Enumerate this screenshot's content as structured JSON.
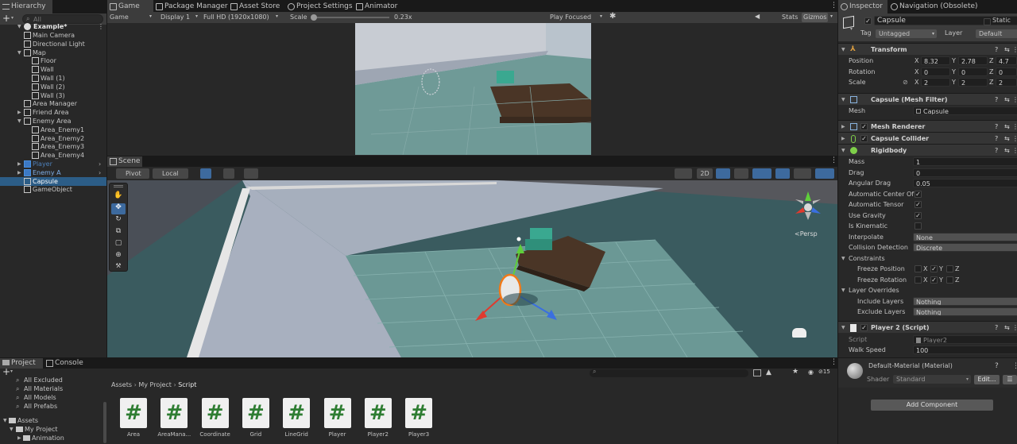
{
  "hierarchy": {
    "tab": "Hierarchy",
    "search_placeholder": "All",
    "scene_name": "Example*",
    "rows": [
      {
        "label": "Main Camera"
      },
      {
        "label": "Directional Light"
      },
      {
        "label": "Map"
      },
      {
        "label": "Floor"
      },
      {
        "label": "Wall"
      },
      {
        "label": "Wall (1)"
      },
      {
        "label": "Wall (2)"
      },
      {
        "label": "Wall (3)"
      },
      {
        "label": "Area Manager"
      },
      {
        "label": "Friend Area"
      },
      {
        "label": "Enemy Area"
      },
      {
        "label": "Area_Enemy1"
      },
      {
        "label": "Area_Enemy2"
      },
      {
        "label": "Area_Enemy3"
      },
      {
        "label": "Area_Enemy4"
      },
      {
        "label": "Player"
      },
      {
        "label": "Enemy A"
      },
      {
        "label": "Capsule"
      },
      {
        "label": "GameObject"
      }
    ]
  },
  "center_tabs": [
    "Game",
    "Package Manager",
    "Asset Store",
    "Project Settings",
    "Animator"
  ],
  "game_toolbar": {
    "mode": "Game",
    "display": "Display 1",
    "resolution": "Full HD (1920x1080)",
    "scale_label": "Scale",
    "scale_value": "0.23x",
    "play_mode": "Play Focused",
    "stats": "Stats",
    "gizmos": "Gizmos"
  },
  "scene": {
    "tab": "Scene",
    "pivot": "Pivot",
    "local": "Local",
    "mode_2d": "2D",
    "persp": "<Persp"
  },
  "bottom": {
    "tabs": [
      "Project",
      "Console"
    ],
    "favorites": [
      "All Excluded",
      "All Materials",
      "All Models",
      "All Prefabs"
    ],
    "tree": [
      "Assets",
      "My Project",
      "Animation"
    ],
    "breadcrumb": [
      "Assets",
      "My Project",
      "Script"
    ],
    "count": "15",
    "assets": [
      "Area",
      "AreaMana...",
      "Coordinate",
      "Grid",
      "LineGrid",
      "Player",
      "Player2",
      "Player3"
    ]
  },
  "inspector": {
    "tabs": [
      "Inspector",
      "Navigation (Obsolete)"
    ],
    "object_name": "Capsule",
    "static_label": "Static",
    "tag_label": "Tag",
    "tag_value": "Untagged",
    "layer_label": "Layer",
    "layer_value": "Default",
    "transform": {
      "title": "Transform",
      "position_label": "Position",
      "position": [
        "8.32",
        "2.78",
        "4.7"
      ],
      "rotation_label": "Rotation",
      "rotation": [
        "0",
        "0",
        "0"
      ],
      "scale_label": "Scale",
      "scale": [
        "2",
        "2",
        "2"
      ]
    },
    "mesh_filter": {
      "title": "Capsule (Mesh Filter)",
      "mesh_label": "Mesh",
      "mesh_value": "Capsule"
    },
    "mesh_renderer": "Mesh Renderer",
    "capsule_collider": "Capsule Collider",
    "rigidbody": {
      "title": "Rigidbody",
      "rows": [
        {
          "label": "Mass",
          "value": "1"
        },
        {
          "label": "Drag",
          "value": "0"
        },
        {
          "label": "Angular Drag",
          "value": "0.05"
        },
        {
          "label": "Automatic Center Of I",
          "value": "✓"
        },
        {
          "label": "Automatic Tensor",
          "value": "✓"
        },
        {
          "label": "Use Gravity",
          "value": "✓"
        },
        {
          "label": "Is Kinematic",
          "value": ""
        },
        {
          "label": "Interpolate",
          "value": "None"
        },
        {
          "label": "Collision Detection",
          "value": "Discrete"
        }
      ],
      "constraints": "Constraints",
      "freeze_position": "Freeze Position",
      "freeze_rotation": "Freeze Rotation",
      "layer_overrides": "Layer Overrides",
      "include_layers": "Include Layers",
      "exclude_layers": "Exclude Layers",
      "nothing": "Nothing"
    },
    "script_comp": {
      "title": "Player 2 (Script)",
      "script_label": "Script",
      "script_value": "Player2",
      "walk_label": "Walk Speed",
      "walk_value": "100"
    },
    "material": {
      "name": "Default-Material (Material)",
      "shader_label": "Shader",
      "shader_value": "Standard",
      "edit": "Edit..."
    },
    "add_component": "Add Component"
  },
  "colors": {
    "selection": "#2c5d87",
    "accent_blue": "#4a8fdc",
    "hash_green": "#2e7d32"
  }
}
